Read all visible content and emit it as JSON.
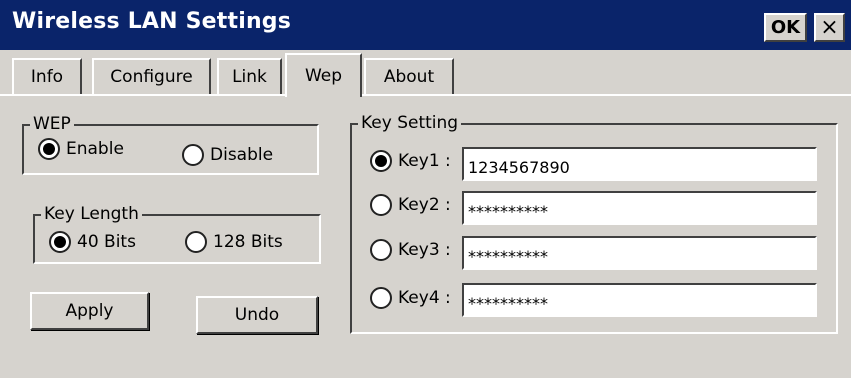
{
  "window": {
    "title": "Wireless LAN Settings",
    "ok_label": "OK",
    "close_label": "×"
  },
  "tabs": [
    {
      "label": "Info"
    },
    {
      "label": "Configure"
    },
    {
      "label": "Link"
    },
    {
      "label": "Wep",
      "active": true
    },
    {
      "label": "About"
    }
  ],
  "wep_group": {
    "legend": "WEP",
    "enable_label": "Enable",
    "disable_label": "Disable",
    "selected": "Enable"
  },
  "key_length_group": {
    "legend": "Key Length",
    "option_40": "40 Bits",
    "option_128": "128 Bits",
    "selected": "40 Bits"
  },
  "buttons": {
    "apply": "Apply",
    "undo": "Undo"
  },
  "key_setting_group": {
    "legend": "Key Setting",
    "selected": "Key1",
    "keys": [
      {
        "label": "Key1 :",
        "value": "1234567890"
      },
      {
        "label": "Key2 :",
        "value": "**********"
      },
      {
        "label": "Key3 :",
        "value": "**********"
      },
      {
        "label": "Key4 :",
        "value": "**********"
      }
    ]
  },
  "colors": {
    "titlebar": "#0a246a",
    "face": "#d6d3ce",
    "field": "#ffffff"
  }
}
